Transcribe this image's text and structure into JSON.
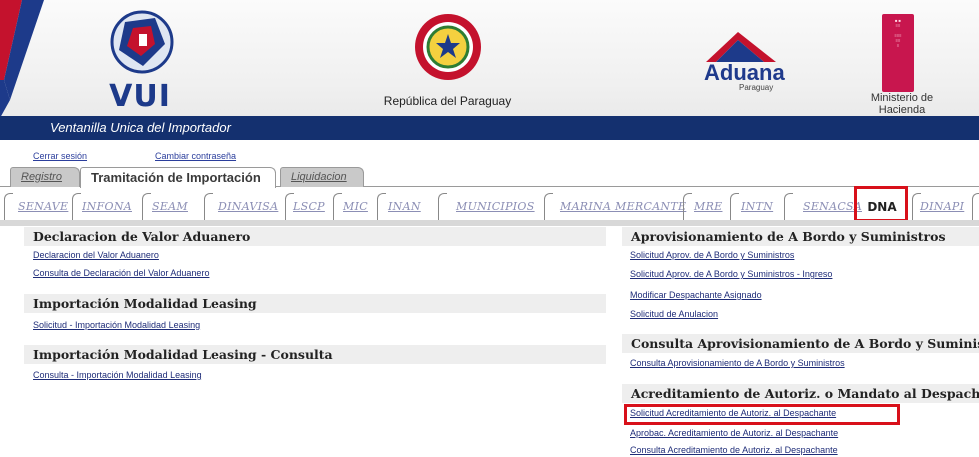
{
  "header": {
    "vui_logo_text": "VUI",
    "country": "República del Paraguay",
    "aduana": "Aduana",
    "aduana_sub": "Paraguay",
    "ministerio": "Ministerio de Hacienda",
    "title": "Ventanilla Unica del Importador"
  },
  "user_links": {
    "logout": "Cerrar sesión",
    "change_password": "Cambiar contraseña"
  },
  "main_tabs": [
    "Registro",
    "Tramitación de Importación",
    "Liquidacion"
  ],
  "active_main_tab": "Tramitación de Importación",
  "sub_tabs": [
    "SENAVE",
    "INFONA",
    "SEAM",
    "DINAVISA",
    "LSCP",
    "MIC",
    "INAN",
    "MUNICIPIOS",
    "MARINA MERCANTE",
    "MRE",
    "INTN",
    "SENACSA",
    "DNA",
    "DINAPI"
  ],
  "active_sub_tab": "DNA",
  "left_sections": [
    {
      "title": "Declaracion de Valor Aduanero",
      "items": [
        "Declaracion del Valor Aduanero",
        "Consulta de Declaración del Valor Aduanero"
      ]
    },
    {
      "title": "Importación Modalidad Leasing",
      "items": [
        "Solicitud - Importación Modalidad Leasing"
      ]
    },
    {
      "title": "Importación Modalidad Leasing - Consulta",
      "items": [
        "Consulta - Importación Modalidad Leasing"
      ]
    }
  ],
  "right_sections": [
    {
      "title": "Aprovisionamiento de A Bordo y Suministros",
      "items": [
        "Solicitud Aprov. de A Bordo y Suministros",
        "Solicitud Aprov. de A Bordo y Suministros - Ingreso",
        "Modificar Despachante Asignado",
        "Solicitud de Anulacion"
      ]
    },
    {
      "title": "Consulta Aprovisionamiento de A Bordo y Suministros",
      "items": [
        "Consulta Aprovisionamiento de A Bordo y Suministros"
      ]
    },
    {
      "title": "Acreditamiento de Autoriz. o Mandato al Despachante",
      "items": [
        "Solicitud Acreditamiento de Autoriz. al Despachante",
        "Aprobac. Acreditamiento de Autoriz. al Despachante",
        "Consulta Acreditamiento de Autoriz. al Despachante"
      ]
    }
  ],
  "colors": {
    "header_bar": "#14306f",
    "highlight": "#d8101a",
    "link": "#1e2c78",
    "inactive_tab_text": "#8c8fb5"
  }
}
